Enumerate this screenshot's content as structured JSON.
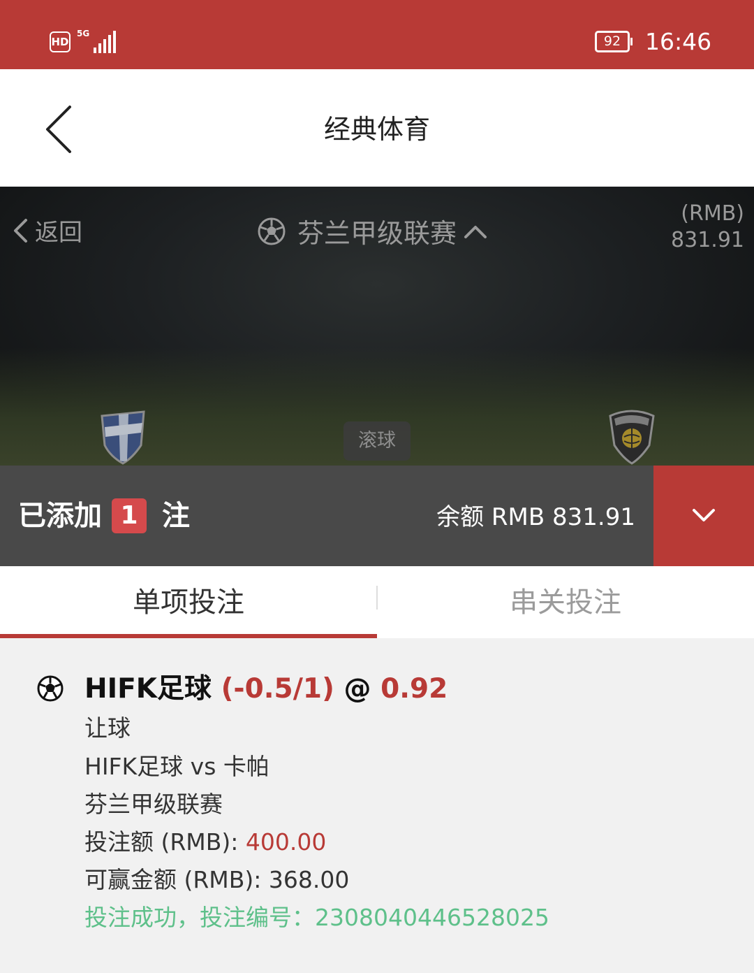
{
  "status_bar": {
    "hd": "HD",
    "network": "5G",
    "battery": "92",
    "time": "16:46"
  },
  "header": {
    "title": "经典体育",
    "back_icon": "chevron-left-icon"
  },
  "match_banner": {
    "back_label": "返回",
    "league": "芬兰甲级联赛",
    "balance_currency": "(RMB)",
    "balance_value": "831.91",
    "live_tag": "滚球",
    "home_crest_icon": "hifk-crest-icon",
    "away_crest_icon": "kapa-crest-icon"
  },
  "bet_bar": {
    "added_prefix": "已添加",
    "count": "1",
    "added_suffix": "注",
    "balance": "余额 RMB 831.91"
  },
  "tabs": [
    {
      "label": "单项投注",
      "active": true
    },
    {
      "label": "串关投注",
      "active": false
    }
  ],
  "bet": {
    "team": "HIFK足球",
    "handicap": "(-0.5/1)",
    "at": "@",
    "odds": "0.92",
    "market": "让球",
    "match": "HIFK足球 vs 卡帕",
    "league": "芬兰甲级联赛",
    "stake_label": "投注额 (RMB): ",
    "stake_value": "400.00",
    "win_label": "可赢金额 (RMB): ",
    "win_value": "368.00",
    "status": "投注成功，投注编号：2308040446528025"
  },
  "colors": {
    "brand_red": "#b83a36",
    "bar_grey": "#494949",
    "success_green": "#5ec08a",
    "badge_red": "#d54a4c"
  }
}
